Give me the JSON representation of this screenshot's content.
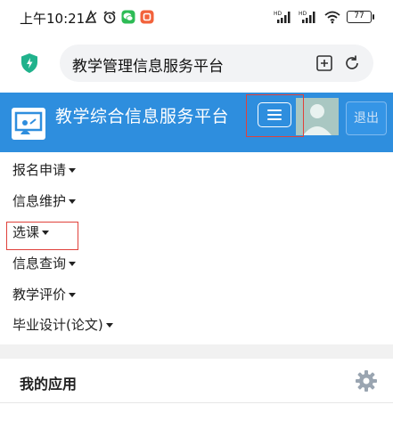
{
  "status_bar": {
    "time": "上午10:21",
    "battery": "77",
    "icons_left": [
      "do-not-disturb-icon",
      "alarm-icon",
      "wechat-icon",
      "app-notification-icon"
    ],
    "icons_right": [
      "hd-signal-icon",
      "hd-signal-icon",
      "wifi-icon",
      "battery-icon"
    ]
  },
  "browser": {
    "address_title": "教学管理信息服务平台",
    "shield_color": "#20b28c"
  },
  "header": {
    "title": "教学综合信息服务平台",
    "logout_label": "退出",
    "background": "#2e8ede"
  },
  "menu": {
    "items": [
      {
        "label": "报名申请"
      },
      {
        "label": "信息维护"
      },
      {
        "label": "选课"
      },
      {
        "label": "信息查询"
      },
      {
        "label": "教学评价"
      },
      {
        "label": "毕业设计(论文)"
      }
    ]
  },
  "apps": {
    "title": "我的应用"
  },
  "highlight_color": "#e0413b"
}
